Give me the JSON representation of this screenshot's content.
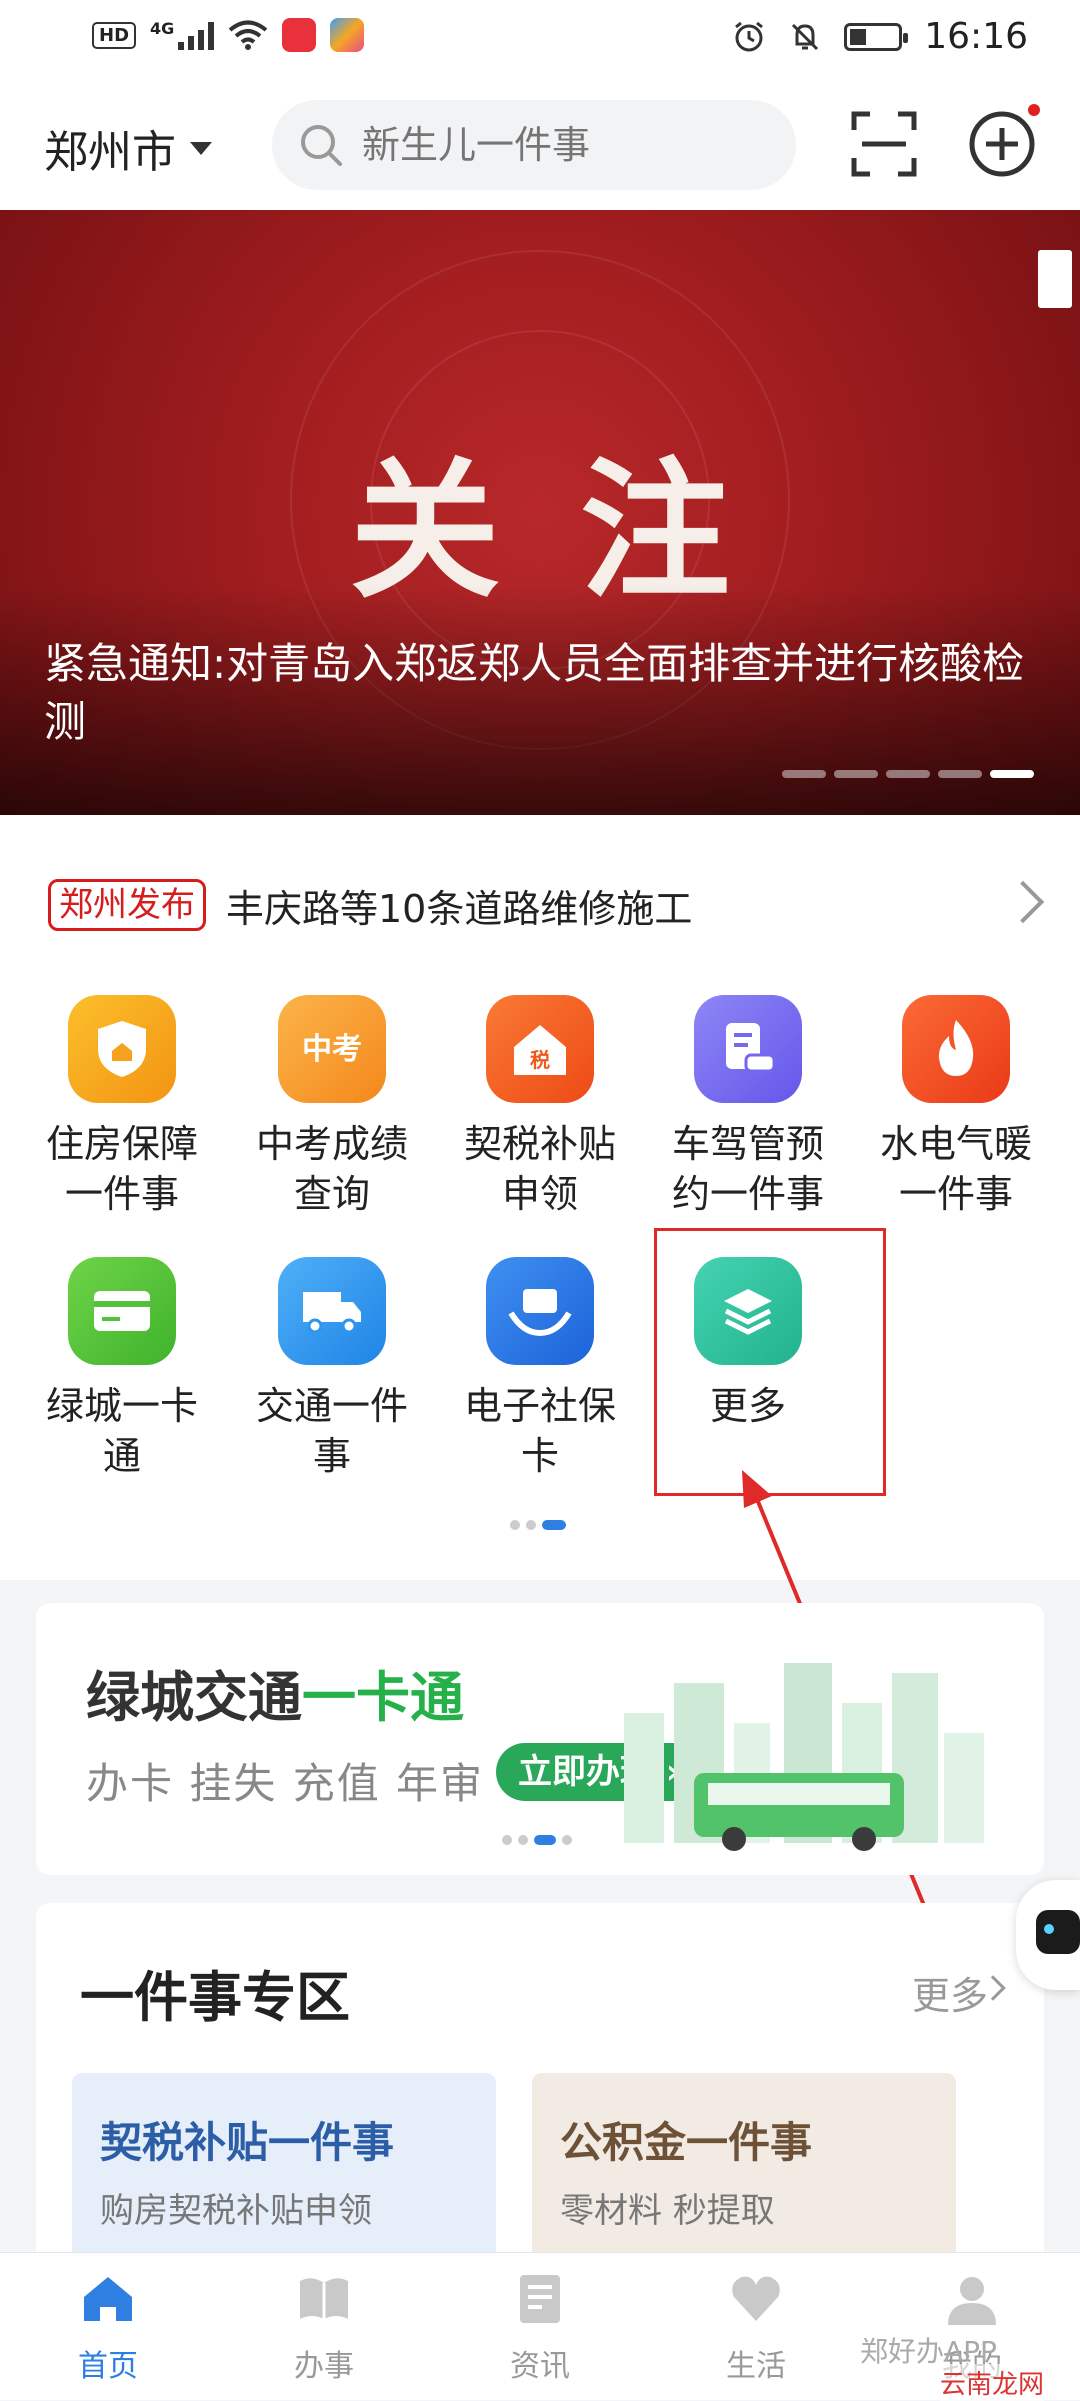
{
  "status_bar": {
    "hd": "HD",
    "network": "4G",
    "time": "16:16"
  },
  "header": {
    "city": "郑州市",
    "search_placeholder": "新生儿一件事"
  },
  "banner": {
    "headline": "关注",
    "caption": "紧急通知:对青岛入郑返郑人员全面排查并进行核酸检测",
    "slide_count": 5,
    "active_slide": 5
  },
  "news": {
    "tag": "郑州发布",
    "text": "丰庆路等10条道路维修施工"
  },
  "services": [
    {
      "label": "住房保障一件事",
      "icon": "house-shield-icon",
      "color": "#f7a81c"
    },
    {
      "label": "中考成绩查询",
      "icon": "exam-score-icon",
      "color": "#f59a2c"
    },
    {
      "label": "契税补贴申领",
      "icon": "tax-house-icon",
      "color": "#f5601f"
    },
    {
      "label": "车驾管预约一件事",
      "icon": "vehicle-appointment-icon",
      "color": "#7b6cf0"
    },
    {
      "label": "水电气暖一件事",
      "icon": "utilities-flame-icon",
      "color": "#f4471f"
    },
    {
      "label": "绿城一卡通",
      "icon": "transit-card-icon",
      "color": "#52c23a"
    },
    {
      "label": "交通一件事",
      "icon": "truck-icon",
      "color": "#2f95ee"
    },
    {
      "label": "电子社保卡",
      "icon": "social-security-card-icon",
      "color": "#2a7de9"
    },
    {
      "label": "更多",
      "icon": "layers-icon",
      "color": "#2cc4a0"
    }
  ],
  "promo_card": {
    "title_main": "绿城交通",
    "title_accent": "一卡通",
    "subtitle": "办卡 挂失 充值 年审",
    "button": "立即办理"
  },
  "zone": {
    "title": "一件事专区",
    "more": "更多",
    "cards": [
      {
        "title": "契税补贴一件事",
        "desc": "购房契税补贴申领",
        "bg": "#e5eef9",
        "color": "#2c5ea8"
      },
      {
        "title": "公积金一件事",
        "desc": "零材料 秒提取",
        "bg": "#f1ebe4",
        "color": "#6e5238"
      }
    ]
  },
  "tabbar": [
    {
      "label": "首页",
      "icon": "home-icon",
      "active": true
    },
    {
      "label": "办事",
      "icon": "book-icon",
      "active": false
    },
    {
      "label": "资讯",
      "icon": "news-icon",
      "active": false
    },
    {
      "label": "生活",
      "icon": "heart-icon",
      "active": false
    },
    {
      "label": "我的",
      "icon": "user-icon",
      "active": false
    }
  ],
  "watermark": {
    "line1": "郑好办APP",
    "line2": "云南龙网"
  },
  "colors": {
    "accent": "#2f7fe3",
    "banner_red": "#a11d1f",
    "highlight_red": "#e02a2a"
  }
}
